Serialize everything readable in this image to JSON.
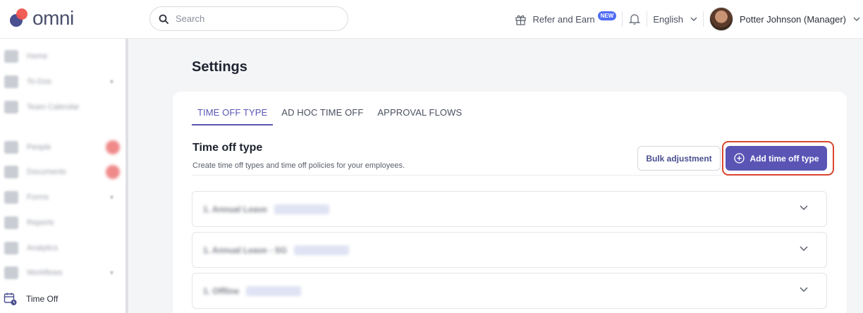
{
  "app": {
    "logo_text": "omni"
  },
  "header": {
    "search_placeholder": "Search",
    "refer_label": "Refer and Earn",
    "new_badge": "NEW",
    "language": "English",
    "user_name": "Potter Johnson (Manager)"
  },
  "sidebar": {
    "items": [
      {
        "label": "Home",
        "icon": "home-icon"
      },
      {
        "label": "To-Dos",
        "icon": "checklist-icon"
      },
      {
        "label": "Team Calendar",
        "icon": "calendar-icon"
      },
      {
        "label": "People",
        "icon": "people-icon"
      },
      {
        "label": "Documents",
        "icon": "documents-icon"
      },
      {
        "label": "Forms",
        "icon": "forms-icon"
      },
      {
        "label": "Reports",
        "icon": "reports-icon"
      },
      {
        "label": "Analytics",
        "icon": "analytics-icon"
      },
      {
        "label": "Workflows",
        "icon": "workflows-icon"
      },
      {
        "label": "Time Off",
        "icon": "time-off-icon"
      }
    ]
  },
  "main": {
    "page_title": "Settings",
    "tabs": [
      {
        "label": "TIME OFF TYPE",
        "active": true
      },
      {
        "label": "AD HOC TIME OFF",
        "active": false
      },
      {
        "label": "APPROVAL FLOWS",
        "active": false
      }
    ],
    "section_title": "Time off type",
    "section_desc": "Create time off types and time off policies for your employees.",
    "bulk_button": "Bulk adjustment",
    "add_button": "Add time off type",
    "rows": [
      {
        "name": "1. Annual Leave",
        "tag": "Company"
      },
      {
        "name": "1. Annual Leave - SG",
        "tag": "Company"
      },
      {
        "name": "1. Offline",
        "tag": "Company"
      }
    ]
  },
  "colors": {
    "accent": "#5a55b5",
    "highlight": "#d9462f",
    "new_badge": "#4f6cf5"
  }
}
